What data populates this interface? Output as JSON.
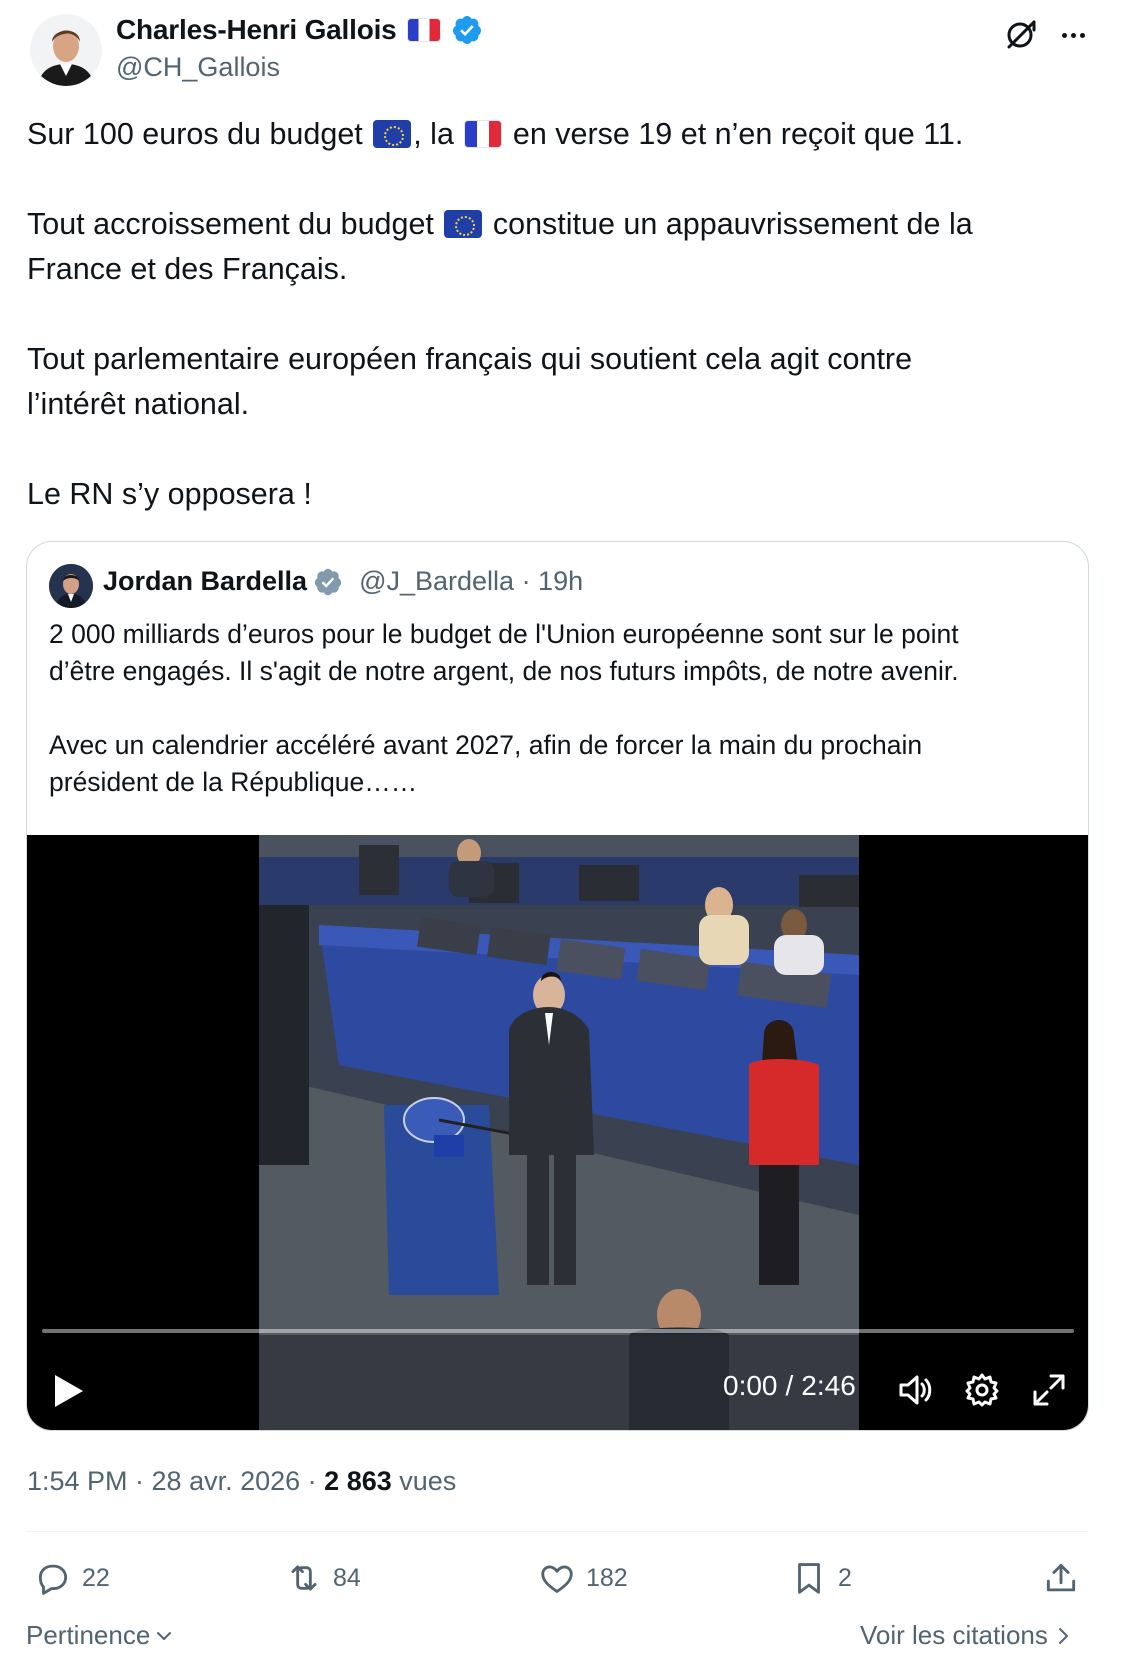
{
  "author": {
    "name": "Charles-Henri Gallois",
    "handle": "@CH_Gallois",
    "verified": true
  },
  "tweet": {
    "line1_a": "Sur 100 euros du budget ",
    "line1_b": ", la ",
    "line1_c": " en verse 19 et n’en reçoit que 11.",
    "line2_a": "Tout accroissement du budget ",
    "line2_b": " constitue un appauvrissement de la",
    "line3": "France et des Français.",
    "line4": "Tout parlementaire européen français qui soutient cela agit contre",
    "line5": "l’intérêt national.",
    "line6": "Le RN s’y opposera !"
  },
  "quote": {
    "name": "Jordan Bardella",
    "handle": "@J_Bardella · 19h",
    "text_line1": "2 000 milliards d’euros pour le budget de l'Union européenne sont sur le point",
    "text_line2": "d’être engagés. Il s'agit de notre argent, de nos futurs impôts, de notre avenir.",
    "text_line3": "Avec un calendrier accéléré avant 2027, afin de forcer la main du prochain",
    "text_line4": "président de la République……"
  },
  "video": {
    "current_time": "0:00",
    "separator": "/",
    "duration": "2:46",
    "progress_fraction": 0.0
  },
  "meta": {
    "time": "1:54 PM · 28 avr. 2026 · ",
    "views_count": "2 863",
    "views_label": " vues"
  },
  "actions": {
    "replies": "22",
    "reposts": "84",
    "likes": "182",
    "bookmarks": "2"
  },
  "footer": {
    "sort_label": "Pertinence",
    "quotes_link": "Voir les citations"
  },
  "icons": {
    "verified_badge": "verified-badge-icon",
    "grok": "grok-icon",
    "more": "more-icon",
    "reply": "reply-icon",
    "repost": "repost-icon",
    "like": "heart-icon",
    "bookmark": "bookmark-icon",
    "share": "share-icon"
  },
  "colors": {
    "verified_blue": "#1d9bf0",
    "verified_gray": "#829aab",
    "text_secondary": "#536471"
  }
}
